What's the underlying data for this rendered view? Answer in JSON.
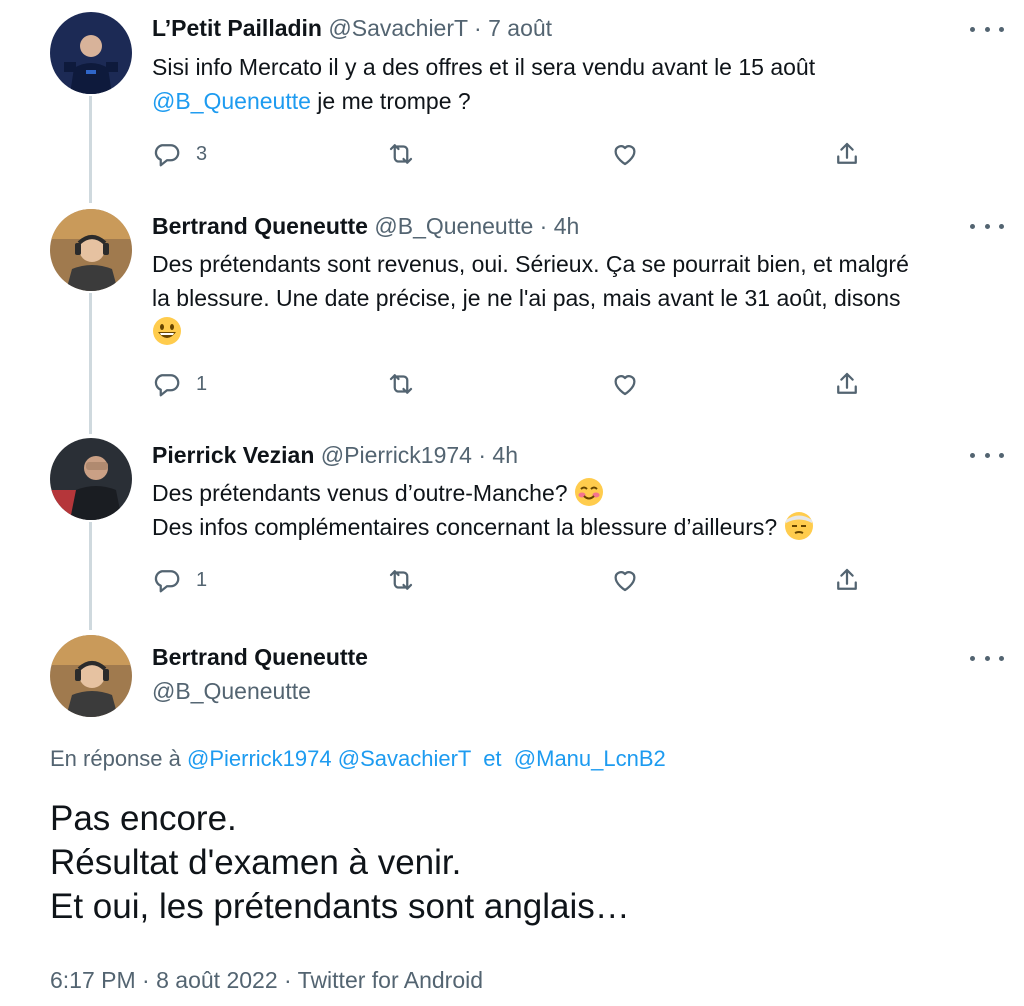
{
  "tweets": [
    {
      "name": "L’Petit Pailladin",
      "handle": "@SavachierT",
      "separator": "·",
      "time": "7 août",
      "text_line1": "Sisi info Mercato il y a des offres et il sera vendu avant le 15 août",
      "mention": "@B_Queneutte",
      "text_line2_rest": " je me trompe ?",
      "replies": "3"
    },
    {
      "name": "Bertrand Queneutte",
      "handle": "@B_Queneutte",
      "separator": "·",
      "time": "4h",
      "text_line1": "Des prétendants sont revenus, oui. Sérieux. Ça se pourrait bien, et malgré",
      "text_line2": "la blessure. Une date précise, je ne l'ai pas, mais avant le 31 août, disons",
      "emoji": "grinning-face-emoji",
      "replies": "1"
    },
    {
      "name": "Pierrick Vezian",
      "handle": "@Pierrick1974",
      "separator": "·",
      "time": "4h",
      "text_line1": "Des prétendants venus d’outre-Manche?",
      "emoji1": "smiling-blush-emoji",
      "text_line2": "Des infos complémentaires concernant la blessure d’ailleurs?",
      "emoji2": "bandaged-head-emoji",
      "replies": "1"
    }
  ],
  "main_tweet": {
    "name": "Bertrand Queneutte",
    "handle": "@B_Queneutte",
    "reply_prefix": "En réponse à",
    "reply_mentions": [
      "@Pierrick1974",
      "@SavachierT"
    ],
    "reply_and": "et",
    "reply_last": "@Manu_LcnB2",
    "text_lines": [
      "Pas encore.",
      "Résultat d'examen à venir.",
      "Et oui, les prétendants sont anglais…"
    ],
    "time": "6:17 PM",
    "separator": "·",
    "date": "8 août 2022",
    "source": "Twitter for Android"
  },
  "icons": {
    "reply": "reply-icon",
    "retweet": "retweet-icon",
    "like": "like-icon",
    "share": "share-icon",
    "more": "more-icon"
  },
  "colors": {
    "text": "#0f1419",
    "secondary": "#536471",
    "link": "#1d9bf0",
    "thread_line": "#cfd9de"
  }
}
